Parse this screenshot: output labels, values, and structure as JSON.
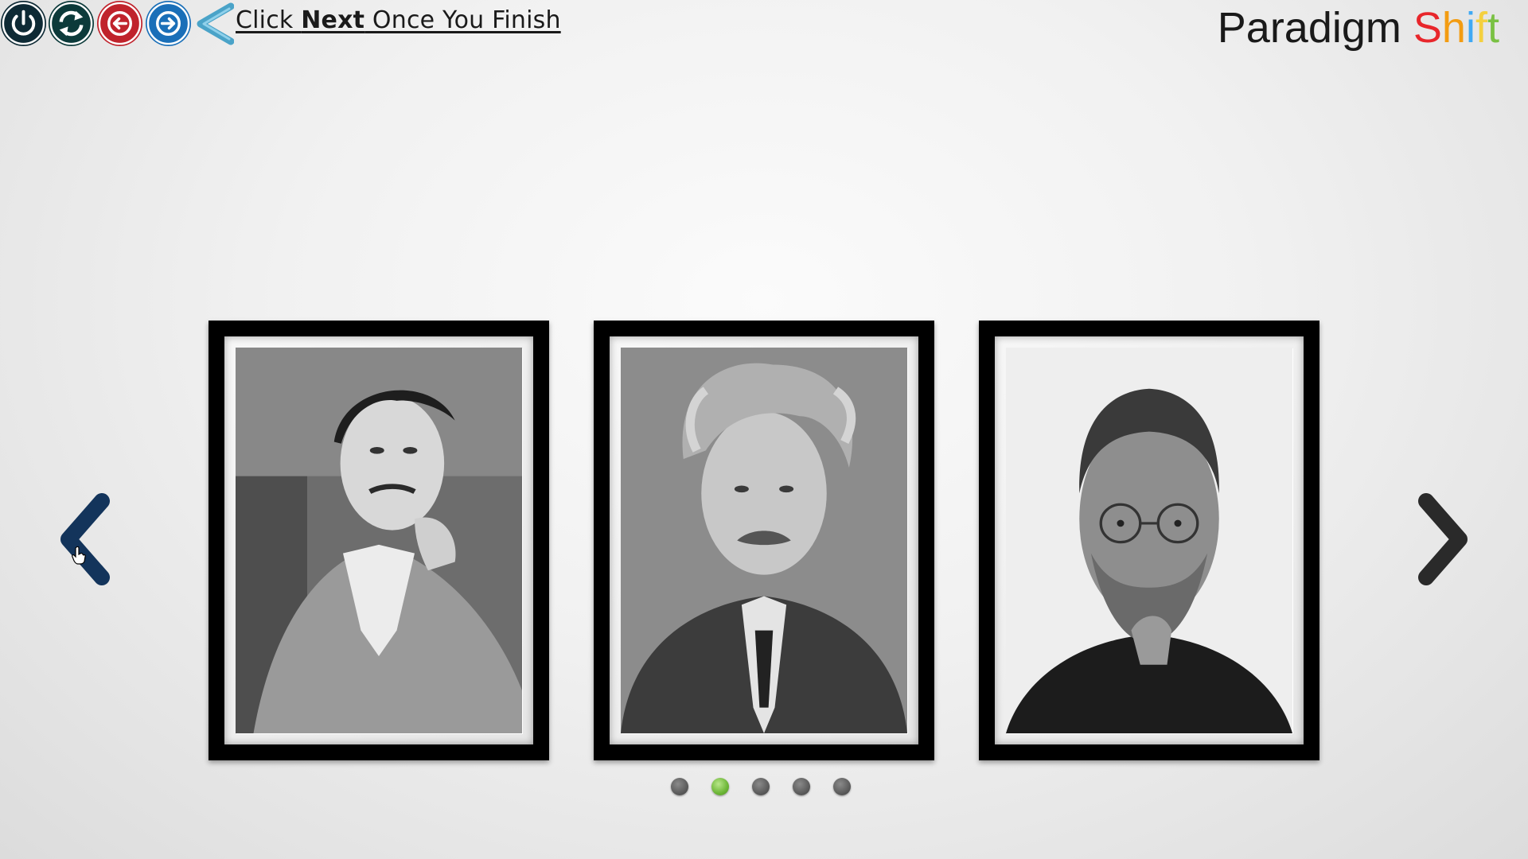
{
  "toolbar": {
    "power_icon": "power-icon",
    "refresh_icon": "refresh-icon",
    "back_icon": "arrow-left-circle-icon",
    "next_icon": "arrow-right-circle-icon",
    "hint_prefix": "Click ",
    "hint_bold": "Next",
    "hint_suffix": " Once You Finish",
    "colors": {
      "power": "#0e2a35",
      "refresh": "#0c3a3a",
      "back": "#c0232c",
      "next": "#1a6fb8",
      "hint_arrow": "#4aa3c8"
    }
  },
  "brand": {
    "word1": "Paradigm",
    "word2_letters": [
      "S",
      "h",
      "i",
      "f",
      "t"
    ],
    "word2_colors": [
      "#e8262b",
      "#f39c12",
      "#3fa9f5",
      "#f4d03f",
      "#7ac143"
    ]
  },
  "carousel": {
    "frames": [
      {
        "subject": "portrait-1"
      },
      {
        "subject": "portrait-2"
      },
      {
        "subject": "portrait-3"
      }
    ],
    "prev_icon": "chevron-left-icon",
    "next_icon": "chevron-right-icon",
    "prev_color": "#13345b",
    "next_color": "#2a2a2a",
    "dots_total": 5,
    "dots_active_index": 1
  }
}
